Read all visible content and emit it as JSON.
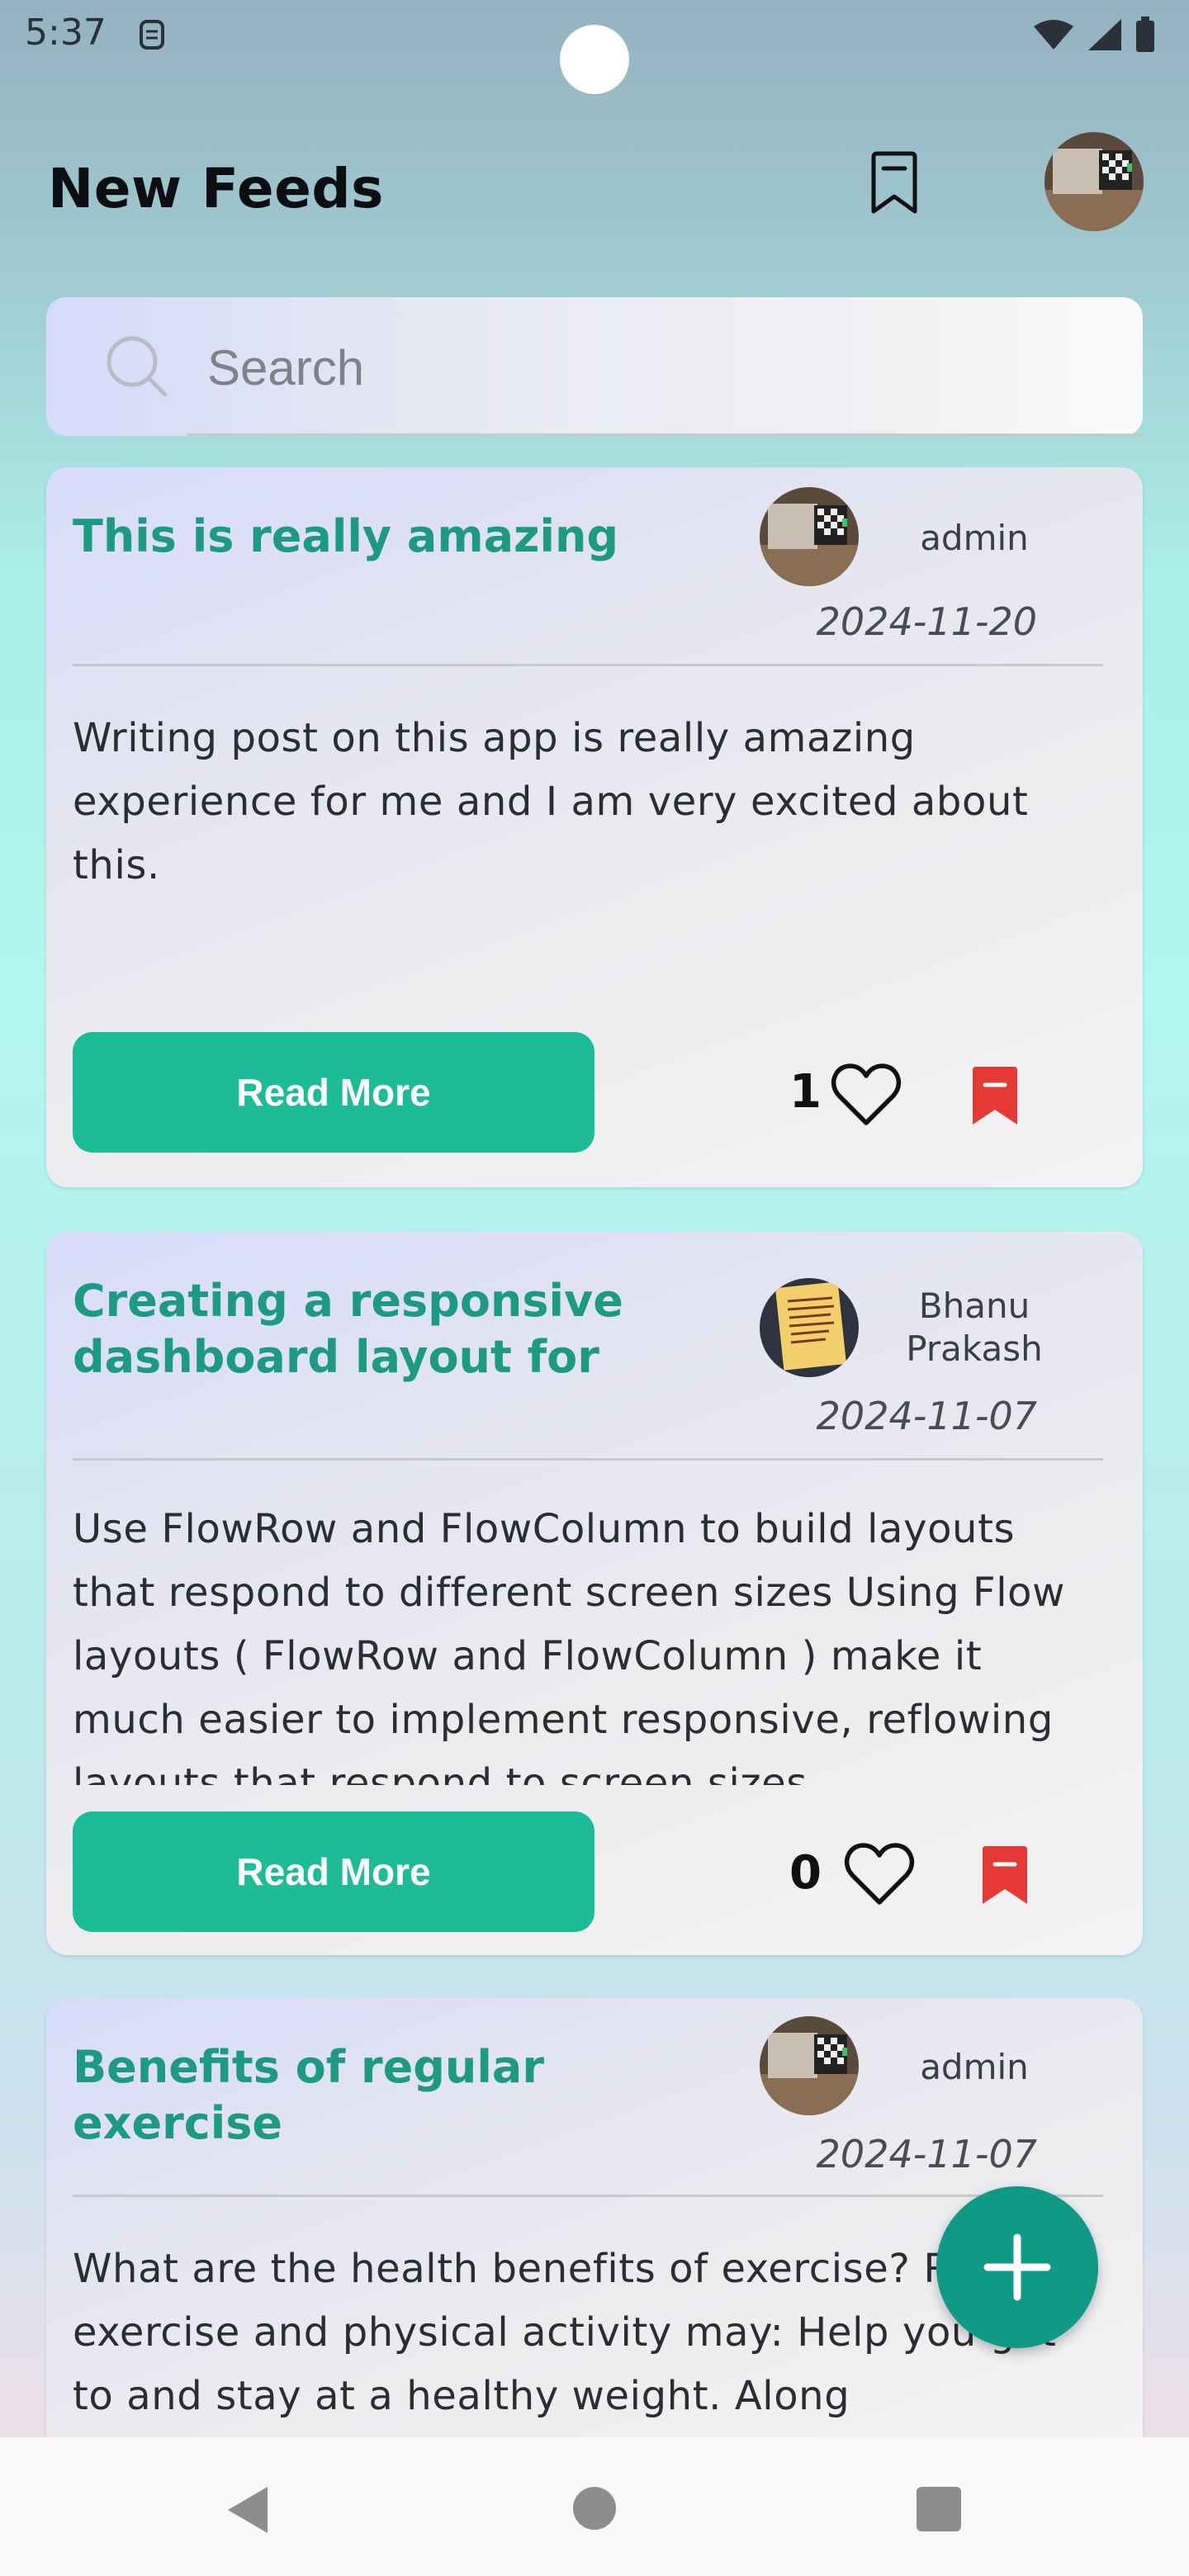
{
  "status_bar": {
    "time": "5:37"
  },
  "header": {
    "title": "New Feeds"
  },
  "search": {
    "placeholder": "Search",
    "value": ""
  },
  "posts": [
    {
      "title": "This is really amazing",
      "author": "admin",
      "date": "2024-11-20",
      "body": "Writing post on this app is really amazing experience for me and I am very excited about this.",
      "read_more_label": "Read More",
      "likes": "1"
    },
    {
      "title": "Creating a responsive dashboard layout for",
      "author": "Bhanu Prakash",
      "date": "2024-11-07",
      "body": "Use FlowRow and FlowColumn to build layouts that respond to different screen sizes Using Flow layouts ( FlowRow and FlowColumn ) make it much easier to implement responsive, reflowing layouts that respond to screen sizes",
      "read_more_label": "Read More",
      "likes": "0"
    },
    {
      "title": "Benefits of regular exercise",
      "author": "admin",
      "date": "2024-11-07",
      "body": "What are the health benefits of exercise? Regular exercise and physical activity may: Help you get to and stay at a healthy weight. Along"
    }
  ],
  "colors": {
    "accent": "#1dbc98",
    "title_green": "#1c9a82",
    "fab": "#0f9a86",
    "bookmark_red": "#e53935"
  },
  "icons": {
    "header_bookmark": "bookmark-outline-icon",
    "search": "search-icon",
    "like": "heart-outline-icon",
    "post_bookmark": "bookmark-filled-icon",
    "fab": "plus-icon"
  }
}
